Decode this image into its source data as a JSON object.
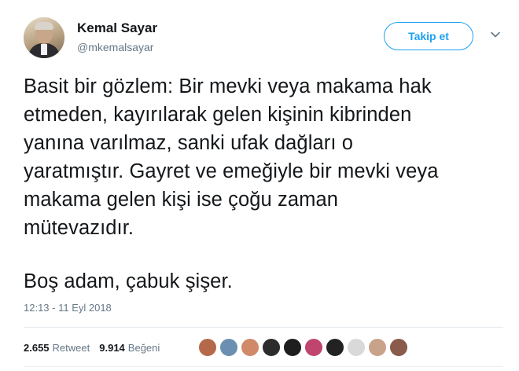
{
  "user": {
    "name": "Kemal Sayar",
    "handle": "@mkemalsayar"
  },
  "follow_button": {
    "label": "Takip et"
  },
  "more_icon": "chevron-down-icon",
  "tweet": {
    "lines": [
      "Basit bir gözlem: Bir mevki veya makama hak",
      "etmeden, kayırılarak gelen kişinin kibrinden",
      "yanına varılmaz, sanki ufak dağları o",
      "yaratmıştır. Gayret ve emeğiyle bir mevki veya",
      "makama gelen kişi ise çoğu zaman",
      "mütevazıdır."
    ],
    "closing_line": "Boş adam, çabuk şişer.",
    "timestamp": "12:13 - 11 Eyl 2018"
  },
  "stats": {
    "retweets_count": "2.655",
    "retweets_label": "Retweet",
    "likes_count": "9.914",
    "likes_label": "Beğeni"
  },
  "likers": [
    {
      "color": "#b46a4a"
    },
    {
      "color": "#6b8fb0"
    },
    {
      "color": "#d08a6a"
    },
    {
      "color": "#2c2c2c"
    },
    {
      "color": "#1e1e1e"
    },
    {
      "color": "#c0456e"
    },
    {
      "color": "#222222"
    },
    {
      "color": "#d9d9d9"
    },
    {
      "color": "#c9a28a"
    },
    {
      "color": "#8a5a4a"
    }
  ],
  "colors": {
    "accent": "#1da1f2",
    "secondary_text": "#657786",
    "primary_text": "#14171a",
    "divider": "#e6ecf0"
  }
}
